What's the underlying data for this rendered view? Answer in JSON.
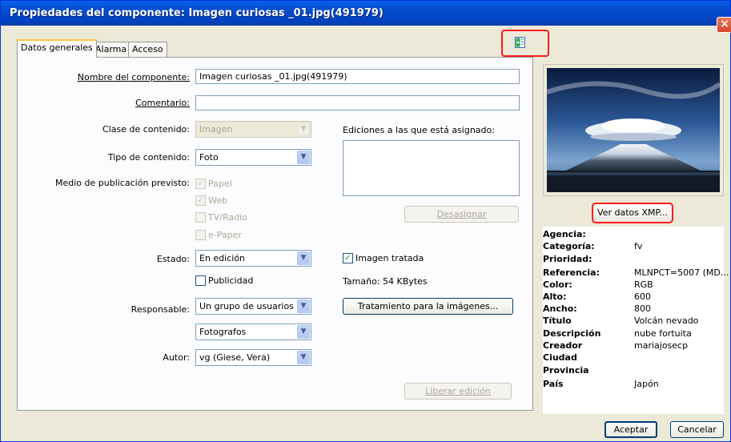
{
  "window": {
    "title": "Propiedades del componente:  Imagen curiosas _01.jpg(491979)",
    "close_glyph": "×"
  },
  "tabs": [
    "Datos generales",
    "Alarma",
    "Acceso"
  ],
  "form": {
    "nombre_label": "Nombre del componente:",
    "nombre_value": "Imagen curiosas _01.jpg(491979)",
    "comentario_label": "Comentario:",
    "comentario_value": "",
    "clase_label": "Clase de contenido:",
    "clase_value": "Imagen",
    "tipo_label": "Tipo de contenido:",
    "tipo_value": "Foto",
    "medio_label": "Medio de publicación previsto:",
    "medio_options": [
      {
        "label": "Papel",
        "checked": true
      },
      {
        "label": "Web",
        "checked": true
      },
      {
        "label": "TV/Radio",
        "checked": false
      },
      {
        "label": "e-Paper",
        "checked": false
      }
    ],
    "ediciones_label": "Ediciones a las que está asignado:",
    "desasignar_button": "Desasignar",
    "estado_label": "Estado:",
    "estado_value": "En edición",
    "imagen_tratada_label": "Imagen tratada",
    "imagen_tratada_checked": true,
    "publicidad_label": "Publicidad",
    "publicidad_checked": false,
    "tamano_text": "Tamaño: 54 KBytes",
    "responsable_label": "Responsable:",
    "responsable_value": "Un grupo de usuarios",
    "responsable_group_value": "Fotografos",
    "tratamiento_button": "Tratamiento para la imágenes...",
    "autor_label": "Autor:",
    "autor_value": "vg (Giese, Vera)",
    "liberar_button": "Liberar edición"
  },
  "xmp_button": "Ver datos XMP...",
  "metadata": [
    {
      "key": "Agencia:",
      "value": ""
    },
    {
      "key": "Categoría:",
      "value": "fv"
    },
    {
      "key": "Prioridad:",
      "value": ""
    },
    {
      "key": "Referencia:",
      "value": "MLNPCT=5007 (MD..."
    },
    {
      "key": "Color:",
      "value": "RGB"
    },
    {
      "key": "Alto:",
      "value": "600"
    },
    {
      "key": "Ancho:",
      "value": "800"
    },
    {
      "key": "Título",
      "value": "Volcán nevado"
    },
    {
      "key": "Descripción",
      "value": "nube fortuita"
    },
    {
      "key": "Creador",
      "value": "mariajosecp"
    },
    {
      "key": "Ciudad",
      "value": ""
    },
    {
      "key": "Provincia",
      "value": ""
    },
    {
      "key": "País",
      "value": "Japón"
    }
  ],
  "footer": {
    "aceptar": "Aceptar",
    "cancelar": "Cancelar"
  },
  "icons": {
    "toolbar_icon": "sheet-add-icon",
    "preview": "mountain-cloud-photo"
  },
  "colors": {
    "titlebar": "#0450d3",
    "highlight": "#ff1a1a",
    "tab_active_accent": "#ffc83c"
  }
}
